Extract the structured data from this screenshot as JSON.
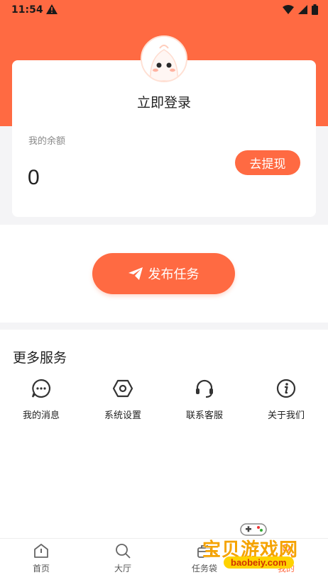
{
  "status_bar": {
    "time": "11:54"
  },
  "profile": {
    "login_text": "立即登录",
    "balance_label": "我的余额",
    "balance_value": "0",
    "withdraw_button": "去提现"
  },
  "publish": {
    "button_label": "发布任务"
  },
  "services": {
    "title": "更多服务",
    "items": [
      {
        "label": "我的消息",
        "icon": "message-icon"
      },
      {
        "label": "系统设置",
        "icon": "settings-icon"
      },
      {
        "label": "联系客服",
        "icon": "headset-icon"
      },
      {
        "label": "关于我们",
        "icon": "info-icon"
      }
    ]
  },
  "tabs": [
    {
      "label": "首页",
      "icon": "home-icon"
    },
    {
      "label": "大厅",
      "icon": "search-icon"
    },
    {
      "label": "任务袋",
      "icon": "bag-icon"
    },
    {
      "label": "我的",
      "icon": "profile-icon",
      "active": true
    }
  ],
  "watermark": {
    "title": "宝贝游戏网",
    "url": "baobeiy.com"
  },
  "colors": {
    "accent": "#ff6a42",
    "background": "#f4f4f6"
  }
}
